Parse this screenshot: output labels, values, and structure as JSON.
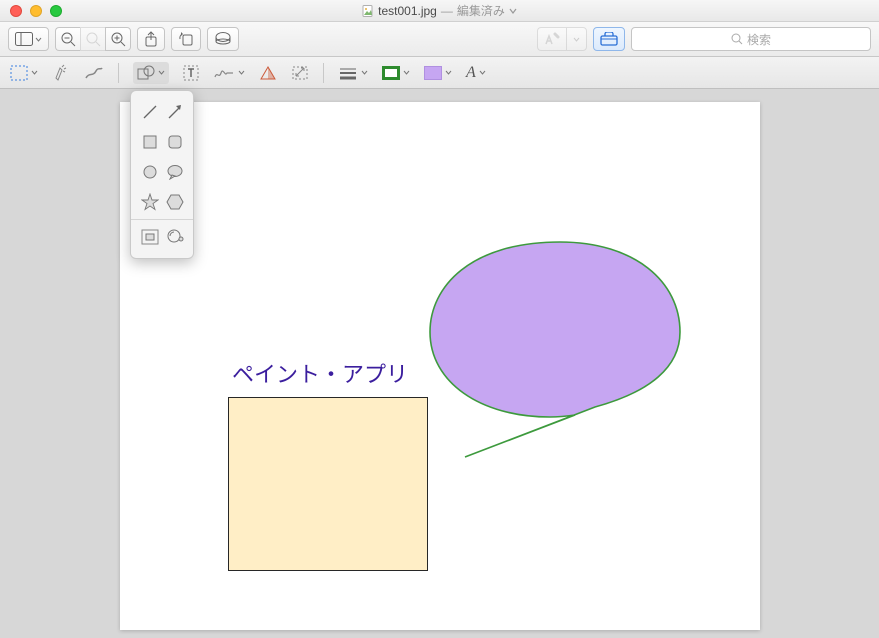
{
  "title": {
    "filename": "test001.jpg",
    "status": "編集済み"
  },
  "toolbar1": {
    "search_placeholder": "検索"
  },
  "canvas": {
    "text": "ペイント・アプリ",
    "rect_fill": "#ffeec6",
    "rect_stroke": "#272727",
    "speech_fill": "#c6a6f2",
    "speech_stroke": "#2e8b2e"
  },
  "markup_toolbar": {
    "stroke_color": "#2e8b2e",
    "fill_color": "#c6a6f2"
  },
  "shape_popover": {
    "items": [
      "line",
      "arrow",
      "square",
      "rounded-rect",
      "circle",
      "ellipse",
      "star",
      "hexagon",
      "mask-rect",
      "loupe"
    ]
  }
}
